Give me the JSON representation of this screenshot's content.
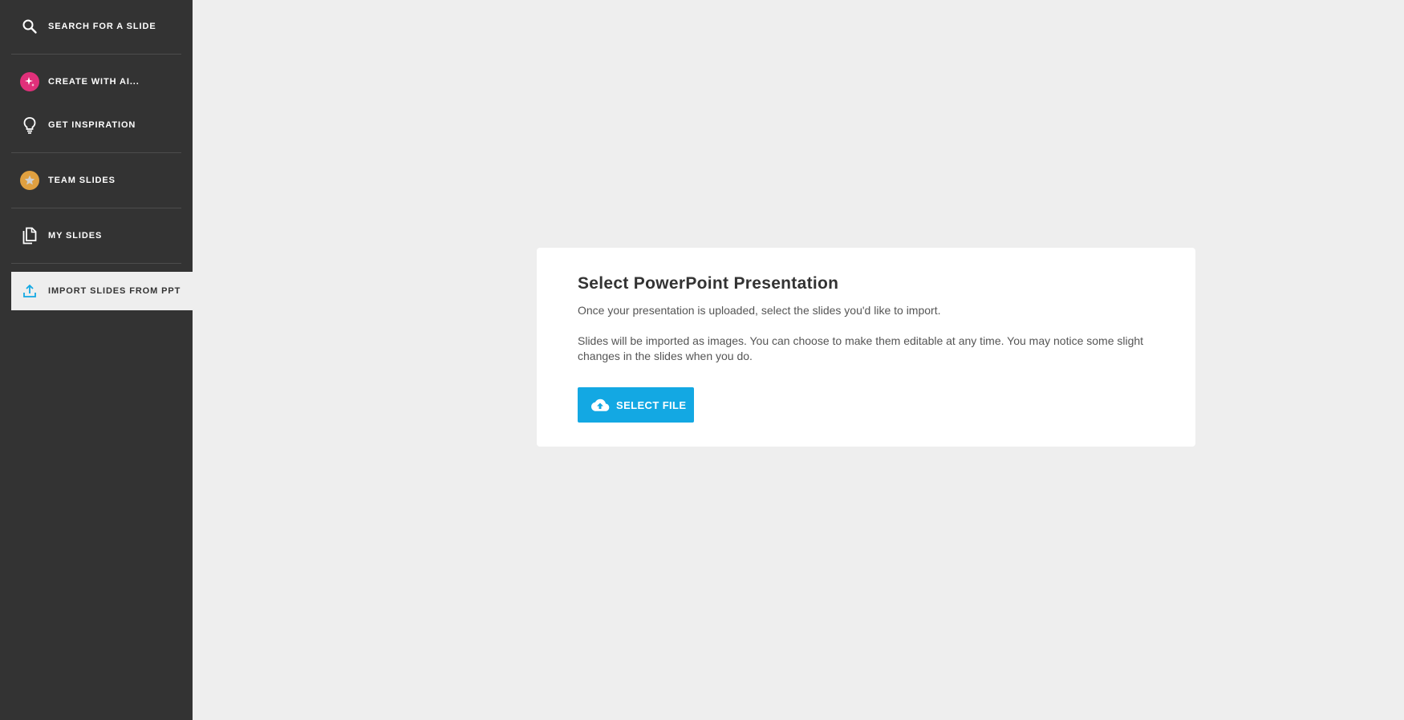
{
  "sidebar": {
    "items": [
      {
        "label": "SEARCH FOR A SLIDE",
        "icon": "search-icon"
      },
      {
        "label": "CREATE WITH AI...",
        "icon": "ai-sparkle-icon"
      },
      {
        "label": "GET INSPIRATION",
        "icon": "lightbulb-icon"
      },
      {
        "label": "TEAM SLIDES",
        "icon": "star-badge-icon"
      },
      {
        "label": "MY SLIDES",
        "icon": "copy-pages-icon"
      },
      {
        "label": "IMPORT SLIDES FROM PPT",
        "icon": "upload-icon"
      }
    ]
  },
  "import_card": {
    "title": "Select PowerPoint Presentation",
    "description_1": "Once your presentation is uploaded, select the slides you'd like to import.",
    "description_2": "Slides will be imported as images. You can choose to make them editable at any time. You may notice some slight changes in the slides when you do.",
    "button_label": "SELECT FILE"
  },
  "colors": {
    "sidebar_bg": "#333333",
    "page_bg": "#eeeeee",
    "accent_blue": "#13a8e3",
    "ai_badge": "#e0307a",
    "team_badge": "#e0a040"
  }
}
